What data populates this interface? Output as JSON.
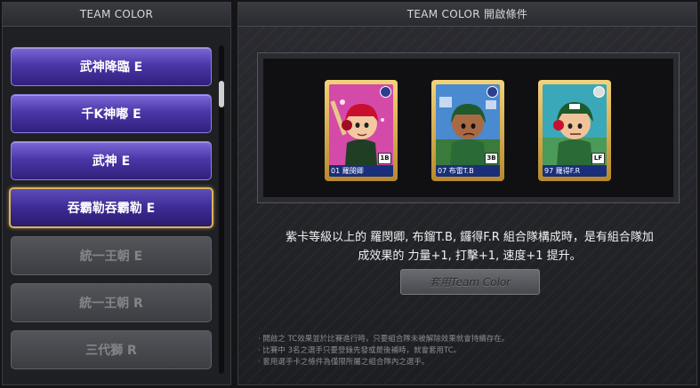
{
  "left_panel": {
    "header": "TEAM COLOR",
    "teams": [
      {
        "label": "武神降臨 E",
        "state": "active"
      },
      {
        "label": "千K神嘟 E",
        "state": "active"
      },
      {
        "label": "武神 E",
        "state": "active"
      },
      {
        "label": "吞霸勒吞霸勒 E",
        "state": "selected"
      },
      {
        "label": "統一王朝 E",
        "state": "locked"
      },
      {
        "label": "統一王朝 R",
        "state": "locked"
      },
      {
        "label": "三代獅 R",
        "state": "locked"
      }
    ]
  },
  "right_panel": {
    "header": "TEAM COLOR 開啟條件",
    "cards": [
      {
        "name": "01 羅閔卿",
        "position": "1B",
        "jersey": "#c8102e",
        "bg": "#d44aa8"
      },
      {
        "name": "07 布雷T.B",
        "position": "3B",
        "jersey": "#2a6a36",
        "bg": "#4a8ad0"
      },
      {
        "name": "97 羅得F.R",
        "position": "LF",
        "jersey": "#2a6a36",
        "bg": "#3aa8b8"
      }
    ],
    "condition_line1": "紫卡等級以上的 羅閔卿, 布鎦T.B, 鑼得F.R 組合隊構成時，是有組合隊加",
    "condition_line2": "成效果的 力量+1, 打擊+1, 速度+1 提升。",
    "apply_button": "套用Team Color",
    "notes": [
      "· 開啟之 TC效果並於比賽進行時，只要組合隊未被解除效果就會持續存在。",
      "· 比賽中 3名之選手只要登錄先發或是後補時，就會套用TC。",
      "· 套用選手卡之條件為僅限所屬之組合隊內之選手。"
    ]
  }
}
